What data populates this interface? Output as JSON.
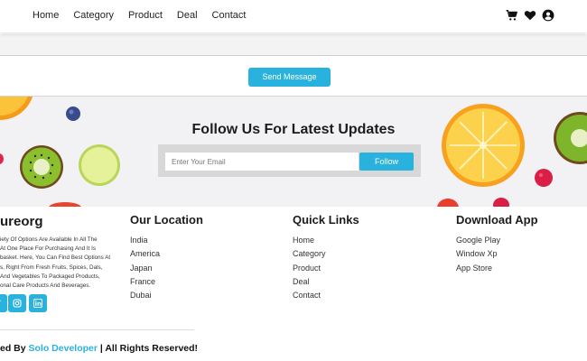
{
  "nav": {
    "links": [
      "Home",
      "Category",
      "Product",
      "Deal",
      "Contact"
    ],
    "icons": [
      "cart-icon",
      "heart-icon",
      "user-icon"
    ]
  },
  "form": {
    "send_label": "Send Message"
  },
  "follow": {
    "title": "Follow Us For Latest Updates",
    "email_placeholder": "Enter Your Email",
    "button_label": "Follow"
  },
  "footer": {
    "brand": "ureorg",
    "description_lines": [
      "iety Of Options Are Available In All The",
      "At One Place For Purchasing And It Is",
      "basket. Here, You Can Find Best Options At",
      "s, Right From Fresh Fruits, Spices, Dals,",
      "And Vegetables To Packaged Products,",
      "onal Care Products And Beverages."
    ],
    "social_icons": [
      "twitter-icon",
      "instagram-icon",
      "linkedin-icon"
    ],
    "copyright_prefix": "ed By ",
    "copyright_author": "Solo Developer",
    "copyright_suffix": " | All Rights Reserved!",
    "columns": [
      {
        "title": "Our Location",
        "items": [
          "India",
          "America",
          "Japan",
          "France",
          "Dubai"
        ]
      },
      {
        "title": "Quick Links",
        "items": [
          "Home",
          "Category",
          "Product",
          "Deal",
          "Contact"
        ]
      },
      {
        "title": "Download App",
        "items": [
          "Google Play",
          "Window Xp",
          "App Store"
        ]
      }
    ]
  },
  "colors": {
    "accent": "#29b2dd",
    "band": "#f2f2f4"
  }
}
